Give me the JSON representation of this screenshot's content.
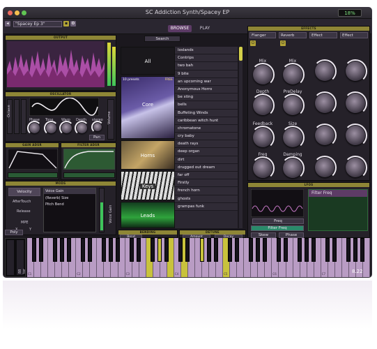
{
  "window": {
    "title": "SC Addiction Synth/Spacey EP",
    "zoom": "18%"
  },
  "toolbar": {
    "preset_name": "\"Spacey Ep 3\"",
    "tabs": [
      "BROWSE",
      "PLAY"
    ],
    "active_tab": "BROWSE"
  },
  "sections": {
    "output": "OUTPUT",
    "oscillator": "OSCILLATOR",
    "gain_adsr": "GAIN ADSR",
    "filter_adsr": "FILTER ADSR",
    "mods": "MODS",
    "bending": "BENDING",
    "detune": "DETUNE",
    "effects": "EFFECTS",
    "lfos": "LFOS"
  },
  "oscillator": {
    "knobs": [
      "Phase",
      "Tone",
      "Warp",
      "Depth"
    ],
    "vertical_labels": [
      "Octave",
      "Semis",
      "Fine"
    ],
    "stereo": "stereo",
    "pan": "Pan",
    "volume": "Volume"
  },
  "mods": {
    "sources": [
      "Velocity",
      "AfterTouch",
      "Release"
    ],
    "target_header": "Voice Gain",
    "targets": [
      "(Reverb) Size",
      "Pitch Bend"
    ],
    "mpe": "MPE",
    "xy": [
      "X",
      "Y"
    ],
    "side_label": "Voice Gain"
  },
  "bend": {
    "bend": "Bend",
    "amount": "Amount",
    "decay": "Decay"
  },
  "browser": {
    "search_label": "Search",
    "tiles": [
      {
        "label": "All",
        "count": ""
      },
      {
        "label": "Core",
        "count": "10 presets",
        "badge": "FREE"
      },
      {
        "label": "Horns",
        "count": ""
      },
      {
        "label": "Keys",
        "count": ""
      },
      {
        "label": "Leads",
        "count": ""
      }
    ],
    "presets": [
      "Ioslands",
      "Contrips",
      "two bah",
      "9 bite",
      "an upcoming war",
      "Anonymous Horro",
      "be sting",
      "bells",
      "Buffeting Winds",
      "caribbean witch hunt",
      "chromatone",
      "cry baby",
      "death rays",
      "deep organ",
      "dirt",
      "drugged out dream",
      "far off",
      "Firstly",
      "french horn",
      "ghosts",
      "grampas funk"
    ]
  },
  "effects": {
    "slots": [
      "Flanger",
      "Reverb",
      "Effect",
      "Effect"
    ],
    "flanger_knobs": [
      "Mix",
      "Depth",
      "Feedback",
      "Freq"
    ],
    "reverb_knobs": [
      "Mix",
      "PreDelay",
      "Size",
      "Damping"
    ]
  },
  "lfo": {
    "target": "Filter Freq",
    "freq": "Freq",
    "filter_freq": "Filter Freq",
    "skew": "Skew",
    "phase": "Phase"
  },
  "keyboard": {
    "poly": "Poly",
    "octave_labels": [
      "C1",
      "C2",
      "C3",
      "C4",
      "C5",
      "C6",
      "C7"
    ],
    "readout": "8.22",
    "side_label": "88 tor"
  },
  "colors": {
    "accent": "#8e8636",
    "highlight_key": "#c8c23c",
    "keys": "#b99cc4",
    "active_tab": "#5d3b66"
  }
}
